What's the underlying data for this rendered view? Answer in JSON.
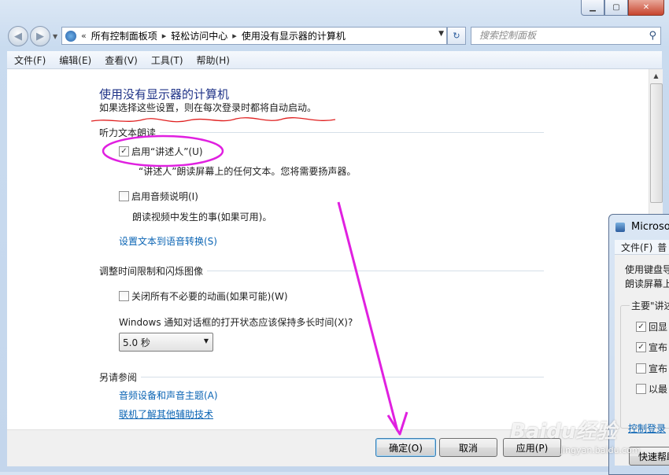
{
  "breadcrumbs": [
    "所有控制面板项",
    "轻松访问中心",
    "使用没有显示器的计算机"
  ],
  "crumb_prefix": "«",
  "search_placeholder": "搜索控制面板",
  "menu": [
    "文件(F)",
    "编辑(E)",
    "查看(V)",
    "工具(T)",
    "帮助(H)"
  ],
  "page": {
    "title": "使用没有显示器的计算机",
    "subtitle": "如果选择这些设置，则在每次登录时都将自动启动。"
  },
  "narration": {
    "heading": "听力文本朗读",
    "narrator_label": "启用“讲述人”(U)",
    "narrator_checked": true,
    "narrator_desc": "“讲述人”朗读屏幕上的任何文本。您将需要扬声器。",
    "audio_desc_label": "启用音频说明(I)",
    "audio_desc_checked": false,
    "audio_desc_desc": "朗读视频中发生的事(如果可用)。",
    "tts_link": "设置文本到语音转换(S)"
  },
  "timing": {
    "heading": "调整时间限制和闪烁图像",
    "animations_label": "关闭所有不必要的动画(如果可能)(W)",
    "animations_checked": false,
    "notify_question": "Windows 通知对话框的打开状态应该保持多长时间(X)?",
    "duration_value": "5.0 秒"
  },
  "see_also": {
    "heading": "另请参阅",
    "links": [
      "音频设备和声音主题(A)",
      "联机了解其他辅助技术"
    ]
  },
  "buttons": {
    "ok": "确定(O)",
    "cancel": "取消",
    "apply": "应用(P)"
  },
  "second_window": {
    "title": "Microso",
    "menu": [
      "文件(F)",
      "普"
    ],
    "text_lines": [
      "使用键盘导",
      "朗读屏幕上"
    ],
    "group_label": "主要\"讲述",
    "checkboxes": [
      {
        "label": "回显",
        "checked": true
      },
      {
        "label": "宣布",
        "checked": true
      },
      {
        "label": "宣布",
        "checked": false
      },
      {
        "label": "以最",
        "checked": false
      }
    ],
    "link": "控制登录",
    "button": "快速帮助"
  },
  "watermark": {
    "logo": "Baidu经验",
    "url": "jingyan.baidu.com"
  },
  "colors": {
    "title_blue": "#1e3287",
    "link_blue": "#0a64b4",
    "annotation_magenta": "#e020e0",
    "underline_red": "#e02020"
  }
}
